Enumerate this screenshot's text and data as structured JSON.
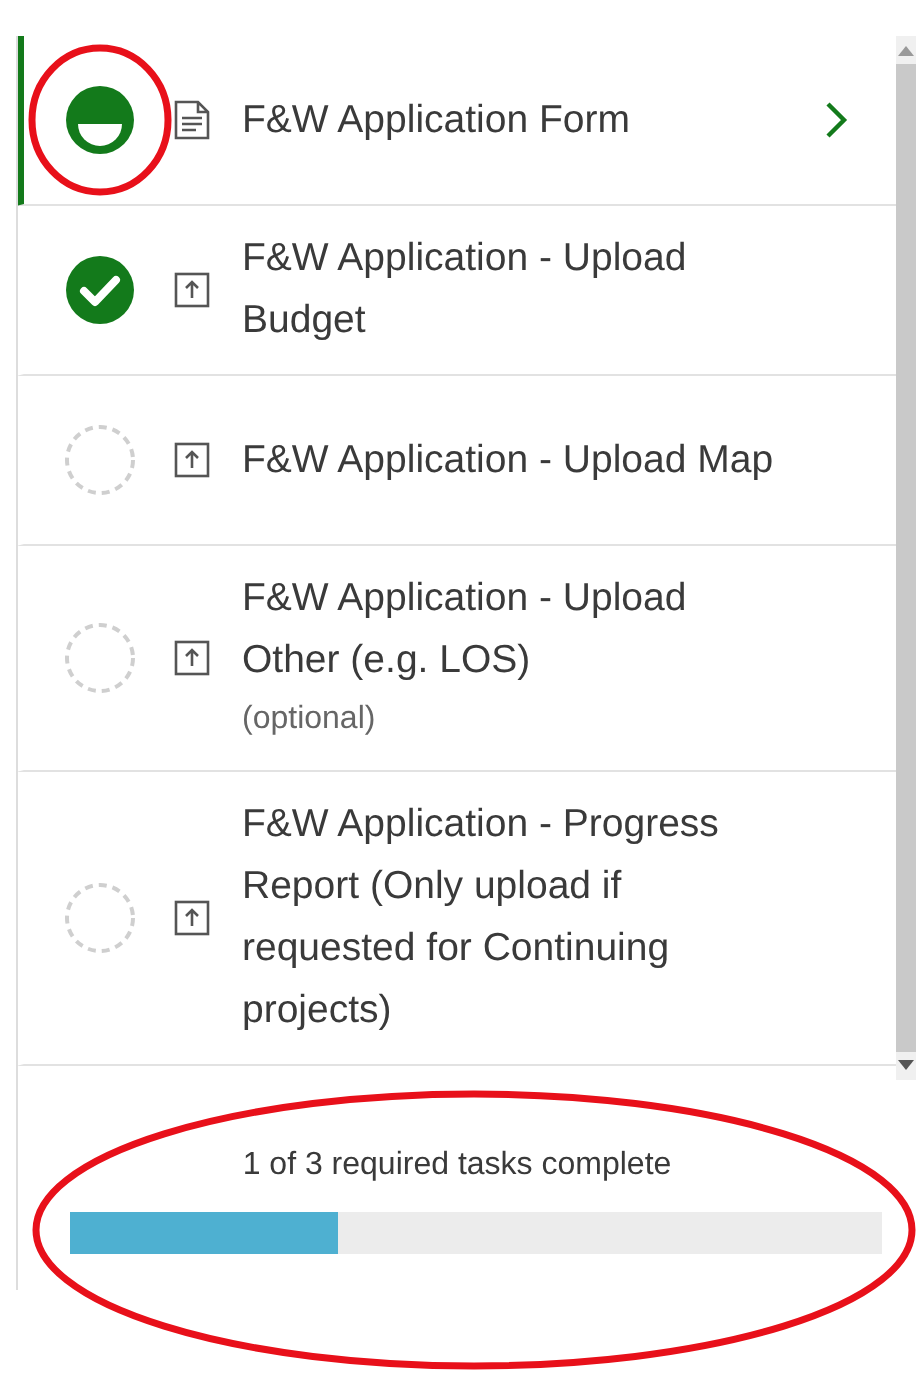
{
  "tasks": [
    {
      "title": "F&W Application Form",
      "kind": "form",
      "started": true,
      "complete": false,
      "selected": true,
      "highlighted": true
    },
    {
      "title": "F&W Application - Upload Budget",
      "kind": "upload",
      "started": true,
      "complete": true,
      "selected": false,
      "highlighted": false
    },
    {
      "title": "F&W Application - Upload Map",
      "kind": "upload",
      "started": false,
      "complete": false,
      "selected": false,
      "highlighted": false
    },
    {
      "title": "F&W Application - Upload Other (e.g. LOS)",
      "note": "(optional)",
      "kind": "upload",
      "started": false,
      "complete": false,
      "selected": false,
      "highlighted": false
    },
    {
      "title": "F&W Application - Progress Report (Only upload if requested for Continuing projects)",
      "kind": "upload",
      "started": false,
      "complete": false,
      "selected": false,
      "highlighted": false
    }
  ],
  "footer": {
    "summary": "1 of 3 required tasks complete",
    "level": 0.33,
    "highlighted": true
  }
}
